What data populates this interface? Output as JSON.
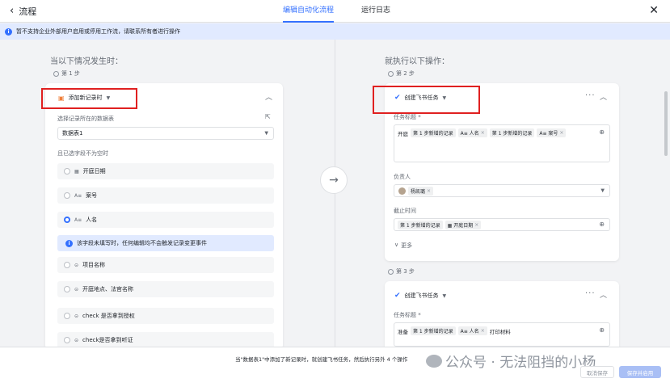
{
  "header": {
    "back_label": "流程",
    "tabs": [
      {
        "label": "编辑自动化流程",
        "active": true
      },
      {
        "label": "运行日志",
        "active": false
      }
    ],
    "close_icon": "close-icon"
  },
  "banner": {
    "text": "暂不支持企业外部用户启用或停用工作流，请联系所有者进行操作"
  },
  "left": {
    "heading": "当以下情况发生时：",
    "step_label": "第 1 步",
    "card": {
      "title": "添加新记录时",
      "table_label": "选择记录所在的数据表",
      "table_value": "数据表1",
      "fields_label": "且已选字段不为空时",
      "options": [
        {
          "label": "开庭日期",
          "icon": "calendar-icon",
          "icon_text": "▦",
          "checked": false
        },
        {
          "label": "案号",
          "icon": "text-field-icon",
          "icon_text": "A≡",
          "checked": false
        },
        {
          "label": "人名",
          "icon": "text-field-icon",
          "icon_text": "A≡",
          "checked": true
        }
      ],
      "hint": "该字段未填写时，任何编辑均不会触发记录变更事件",
      "options2": [
        {
          "label": "项目名称",
          "icon": "option-icon",
          "icon_text": "⊝",
          "checked": false
        },
        {
          "label": "开庭地点、法官名称",
          "icon": "option-icon",
          "icon_text": "⊝",
          "checked": false
        },
        {
          "label": "check 是否拿到授权",
          "icon": "option-icon",
          "icon_text": "⊝",
          "checked": false
        },
        {
          "label": "check是否拿到听证",
          "icon": "option-icon",
          "icon_text": "⊝",
          "checked": false
        }
      ]
    }
  },
  "right": {
    "heading": "就执行以下操作：",
    "step2_label": "第 2 步",
    "card1": {
      "title": "创建飞书任务",
      "task_title_label": "任务标题 *",
      "task_tokens": {
        "prefix": "开庭",
        "t1": "第 1 步新增的记录",
        "t2": "A≡ 人名",
        "t3": "第 1 步新增的记录",
        "t4": "A≡ 案号"
      },
      "assignee_label": "负责人",
      "assignee_value": "杨凯璐",
      "deadline_label": "截止时间",
      "deadline_t1": "第 1 步新增的记录",
      "deadline_t2": "▦ 开庭日期",
      "more_label": "更多"
    },
    "step3_label": "第 3 步",
    "card2": {
      "title": "创建飞书任务",
      "task_title_label": "任务标题 *",
      "prefix": "准备",
      "t1": "第 1 步新增的记录",
      "t2": "A≡ 人名",
      "suffix": "打印材料"
    }
  },
  "footer": {
    "summary": "当\"数据表1\"中添加了新记录时，就创建飞书任务，然后执行另外 4 个操作",
    "watermark": "公众号 · 无法阻挡的小杨",
    "btn_cancel": "取消保存",
    "btn_save": "保存并启用"
  },
  "colors": {
    "accent": "#3370ff",
    "highlight_box": "#e02020",
    "banner_bg": "#e1eaff"
  }
}
